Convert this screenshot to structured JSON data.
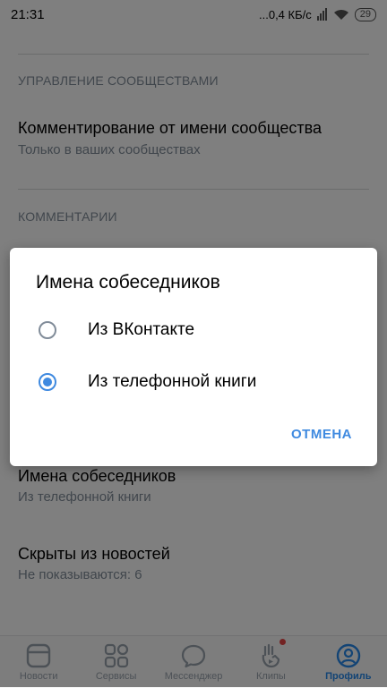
{
  "status_bar": {
    "time": "21:31",
    "network": "...0,4 КБ/с",
    "battery": "29"
  },
  "settings": {
    "community_section_header": "УПРАВЛЕНИЕ СООБЩЕСТВАМИ",
    "comment_as_community_title": "Комментирование от имени сообщества",
    "comment_as_community_value": "Только в ваших сообществах",
    "comments_section_header": "КОММЕНТАРИИ",
    "interlocutor_names_title": "Имена собеседников",
    "interlocutor_names_value": "Из телефонной книги",
    "hidden_from_news_title": "Скрыты из новостей",
    "hidden_from_news_value": "Не показываются: 6"
  },
  "dialog": {
    "title": "Имена собеседников",
    "options": [
      {
        "label": "Из ВКонтакте",
        "selected": false
      },
      {
        "label": "Из телефонной книги",
        "selected": true
      }
    ],
    "cancel_label": "ОТМЕНА"
  },
  "tab_bar": {
    "tabs": [
      {
        "label": "Новости",
        "icon": "news-icon",
        "active": false
      },
      {
        "label": "Сервисы",
        "icon": "services-icon",
        "active": false
      },
      {
        "label": "Мессенджер",
        "icon": "messenger-icon",
        "active": false
      },
      {
        "label": "Клипы",
        "icon": "clips-icon",
        "active": false,
        "badge": true
      },
      {
        "label": "Профиль",
        "icon": "profile-icon",
        "active": true
      }
    ]
  },
  "colors": {
    "accent": "#2688eb",
    "secondary_text": "#818c99",
    "badge": "#e64646"
  }
}
